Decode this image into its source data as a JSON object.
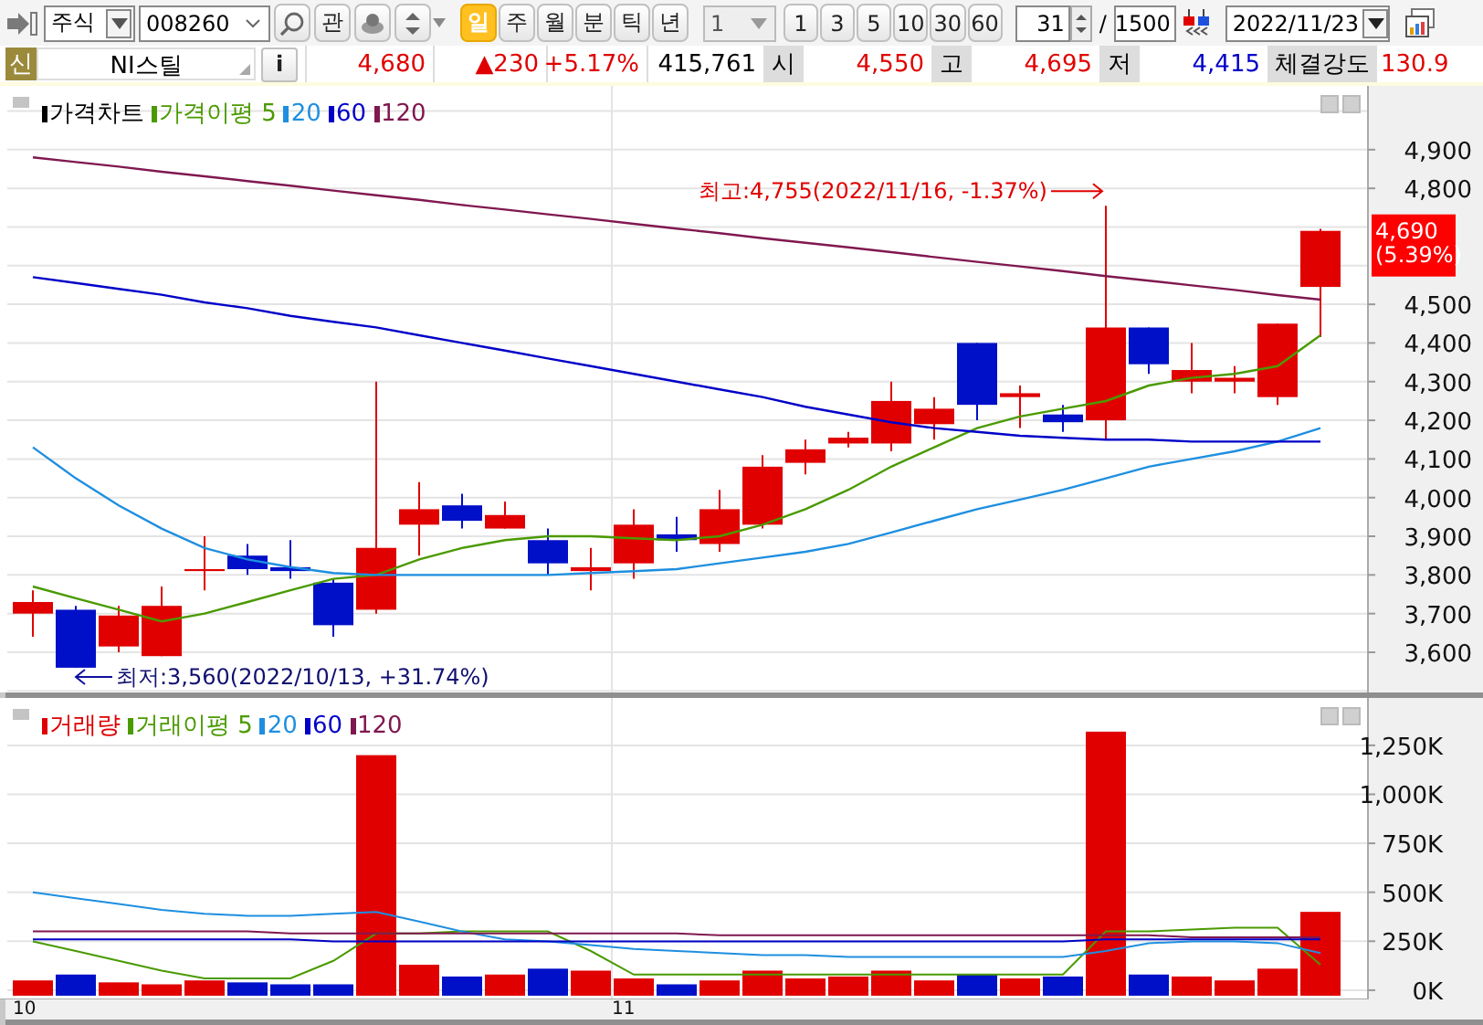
{
  "toolbar": {
    "market": "주식",
    "code": "008260",
    "watch": "관",
    "periods": [
      {
        "label": "일",
        "selected": true
      },
      {
        "label": "주",
        "selected": false
      },
      {
        "label": "월",
        "selected": false
      },
      {
        "label": "분",
        "selected": false
      },
      {
        "label": "틱",
        "selected": false
      },
      {
        "label": "년",
        "selected": false
      }
    ],
    "unit": "1",
    "intervals": [
      {
        "label": "1"
      },
      {
        "label": "3"
      },
      {
        "label": "5"
      },
      {
        "label": "10"
      },
      {
        "label": "30"
      },
      {
        "label": "60"
      }
    ],
    "count": "31",
    "separator": "/",
    "total": "1500",
    "date": "2022/11/23"
  },
  "quote": {
    "badge": "신",
    "name": "NI스틸",
    "info": "i",
    "price": "4,680",
    "change": "▲230",
    "rate": "+5.17%",
    "volume": "415,761",
    "fields": [
      {
        "label": "시",
        "value": "4,550",
        "color": "#e00000"
      },
      {
        "label": "고",
        "value": "4,695",
        "color": "#e00000"
      },
      {
        "label": "저",
        "value": "4,415",
        "color": "#0000c8"
      },
      {
        "label": "체결강도",
        "value": "130.9",
        "color": "#e00000"
      }
    ]
  },
  "price_panel": {
    "candle_legend": {
      "label": "가격차트",
      "color": "#000000"
    },
    "current_price": "4,690",
    "current_rate": "(5.39%)",
    "chart_data": {
      "type": "candlestick",
      "grid": true,
      "ylim": [
        3496,
        5065
      ],
      "yticks": [
        {
          "value": 4900,
          "label": "4,900"
        },
        {
          "value": 4800,
          "label": "4,800"
        },
        {
          "value": 4500,
          "label": "4,500"
        },
        {
          "value": 4400,
          "label": "4,400"
        },
        {
          "value": 4300,
          "label": "4,300"
        },
        {
          "value": 4200,
          "label": "4,200"
        },
        {
          "value": 4100,
          "label": "4,100"
        },
        {
          "value": 4000,
          "label": "4,000"
        },
        {
          "value": 3900,
          "label": "3,900"
        },
        {
          "value": 3800,
          "label": "3,800"
        },
        {
          "value": 3700,
          "label": "3,700"
        },
        {
          "value": 3600,
          "label": "3,600"
        }
      ],
      "ohlc": [
        [
          3700,
          3760,
          3640,
          3730
        ],
        [
          3710,
          3720,
          3560,
          3560
        ],
        [
          3615,
          3720,
          3600,
          3695
        ],
        [
          3590,
          3770,
          3590,
          3720
        ],
        [
          3810,
          3900,
          3760,
          3815
        ],
        [
          3850,
          3880,
          3800,
          3815
        ],
        [
          3820,
          3890,
          3790,
          3810
        ],
        [
          3780,
          3790,
          3640,
          3670
        ],
        [
          3710,
          4300,
          3700,
          3870
        ],
        [
          3930,
          4040,
          3850,
          3970
        ],
        [
          3980,
          4010,
          3920,
          3940
        ],
        [
          3920,
          3990,
          3920,
          3955
        ],
        [
          3890,
          3920,
          3800,
          3830
        ],
        [
          3810,
          3870,
          3760,
          3820
        ],
        [
          3830,
          3970,
          3790,
          3930
        ],
        [
          3905,
          3950,
          3860,
          3890
        ],
        [
          3880,
          4020,
          3860,
          3970
        ],
        [
          3930,
          4110,
          3920,
          4080
        ],
        [
          4090,
          4150,
          4060,
          4125
        ],
        [
          4140,
          4170,
          4130,
          4155
        ],
        [
          4140,
          4300,
          4120,
          4250
        ],
        [
          4190,
          4260,
          4150,
          4230
        ],
        [
          4400,
          4400,
          4200,
          4240
        ],
        [
          4260,
          4290,
          4180,
          4270
        ],
        [
          4215,
          4240,
          4170,
          4195
        ],
        [
          4200,
          4755,
          4150,
          4440
        ],
        [
          4440,
          4440,
          4320,
          4345
        ],
        [
          4300,
          4400,
          4270,
          4330
        ],
        [
          4300,
          4340,
          4270,
          4310
        ],
        [
          4260,
          4450,
          4240,
          4450
        ],
        [
          4545,
          4695,
          4415,
          4690
        ]
      ],
      "series": [
        {
          "name": "가격이평 5",
          "type": "line",
          "color": "#4a9a00",
          "values": [
            3770,
            3740,
            3710,
            3680,
            3700,
            3730,
            3760,
            3790,
            3800,
            3840,
            3870,
            3890,
            3900,
            3900,
            3895,
            3890,
            3900,
            3930,
            3970,
            4020,
            4080,
            4130,
            4180,
            4210,
            4230,
            4250,
            4290,
            4310,
            4320,
            4340,
            4420
          ]
        },
        {
          "name": "20",
          "type": "line",
          "color": "#1e8fe0",
          "values": [
            4130,
            4050,
            3980,
            3920,
            3870,
            3840,
            3820,
            3805,
            3800,
            3800,
            3800,
            3800,
            3800,
            3805,
            3810,
            3815,
            3830,
            3845,
            3860,
            3880,
            3910,
            3940,
            3970,
            3995,
            4020,
            4050,
            4080,
            4100,
            4120,
            4145,
            4180
          ]
        },
        {
          "name": "60",
          "type": "line",
          "color": "#0000c8",
          "values": [
            4570,
            4555,
            4540,
            4525,
            4505,
            4490,
            4470,
            4455,
            4440,
            4420,
            4400,
            4380,
            4360,
            4340,
            4320,
            4300,
            4280,
            4260,
            4235,
            4215,
            4195,
            4180,
            4170,
            4160,
            4155,
            4150,
            4150,
            4145,
            4145,
            4145,
            4145
          ]
        },
        {
          "name": "120",
          "type": "line",
          "color": "#801850",
          "values": [
            4880,
            4868,
            4856,
            4843,
            4831,
            4819,
            4807,
            4794,
            4782,
            4770,
            4757,
            4745,
            4733,
            4721,
            4708,
            4696,
            4684,
            4671,
            4659,
            4647,
            4635,
            4622,
            4610,
            4598,
            4586,
            4573,
            4561,
            4549,
            4537,
            4524,
            4512
          ]
        }
      ],
      "annotations": [
        "최고:4,755(2022/11/16, -1.37%)",
        "최저:3,560(2022/10/13, +31.74%)"
      ]
    }
  },
  "volume_panel": {
    "month_labels": [
      "10",
      "11"
    ],
    "chart_data": {
      "type": "bar",
      "grid": true,
      "ylim": [
        -47,
        1492
      ],
      "yticks": [
        {
          "value": 1250,
          "label": "1,250K"
        },
        {
          "value": 1000,
          "label": "1,000K"
        },
        {
          "value": 750,
          "label": "750K"
        },
        {
          "value": 500,
          "label": "500K"
        },
        {
          "value": 250,
          "label": "250K"
        },
        {
          "value": 0,
          "label": "0K"
        }
      ],
      "series": [
        {
          "name": "거래량",
          "color": "#e00000",
          "values": [
            50,
            80,
            40,
            30,
            50,
            40,
            30,
            30,
            1200,
            130,
            70,
            80,
            110,
            100,
            60,
            30,
            50,
            100,
            60,
            70,
            100,
            50,
            80,
            60,
            70,
            1320,
            80,
            70,
            50,
            110,
            400
          ],
          "colors": [
            "#e00000",
            "#0010c8",
            "#e00000",
            "#e00000",
            "#e00000",
            "#0010c8",
            "#0010c8",
            "#0010c8",
            "#e00000",
            "#e00000",
            "#0010c8",
            "#e00000",
            "#0010c8",
            "#e00000",
            "#e00000",
            "#0010c8",
            "#e00000",
            "#e00000",
            "#e00000",
            "#e00000",
            "#e00000",
            "#e00000",
            "#0010c8",
            "#e00000",
            "#0010c8",
            "#e00000",
            "#0010c8",
            "#e00000",
            "#e00000",
            "#e00000",
            "#e00000"
          ]
        },
        {
          "name": "거래이평 5",
          "type": "line",
          "color": "#4a9a00",
          "values": [
            250,
            200,
            150,
            100,
            60,
            60,
            60,
            150,
            290,
            290,
            300,
            300,
            300,
            200,
            80,
            80,
            80,
            80,
            80,
            80,
            80,
            80,
            80,
            80,
            80,
            300,
            300,
            310,
            320,
            320,
            130
          ]
        },
        {
          "name": "20",
          "type": "line",
          "color": "#1e8fe0",
          "values": [
            500,
            470,
            440,
            410,
            390,
            380,
            380,
            390,
            400,
            350,
            300,
            260,
            250,
            230,
            210,
            200,
            190,
            180,
            180,
            170,
            170,
            170,
            170,
            170,
            170,
            200,
            240,
            250,
            250,
            240,
            190
          ]
        },
        {
          "name": "60",
          "type": "line",
          "color": "#0000c8",
          "values": [
            260,
            260,
            260,
            260,
            260,
            260,
            260,
            250,
            250,
            250,
            250,
            250,
            250,
            250,
            250,
            250,
            250,
            250,
            250,
            250,
            250,
            250,
            250,
            250,
            250,
            260,
            260,
            260,
            260,
            260,
            260
          ]
        },
        {
          "name": "120",
          "type": "line",
          "color": "#801850",
          "values": [
            300,
            300,
            300,
            300,
            300,
            300,
            290,
            290,
            290,
            290,
            290,
            290,
            290,
            290,
            290,
            290,
            280,
            280,
            280,
            280,
            280,
            280,
            280,
            280,
            280,
            280,
            280,
            270,
            270,
            270,
            270
          ]
        }
      ]
    }
  }
}
